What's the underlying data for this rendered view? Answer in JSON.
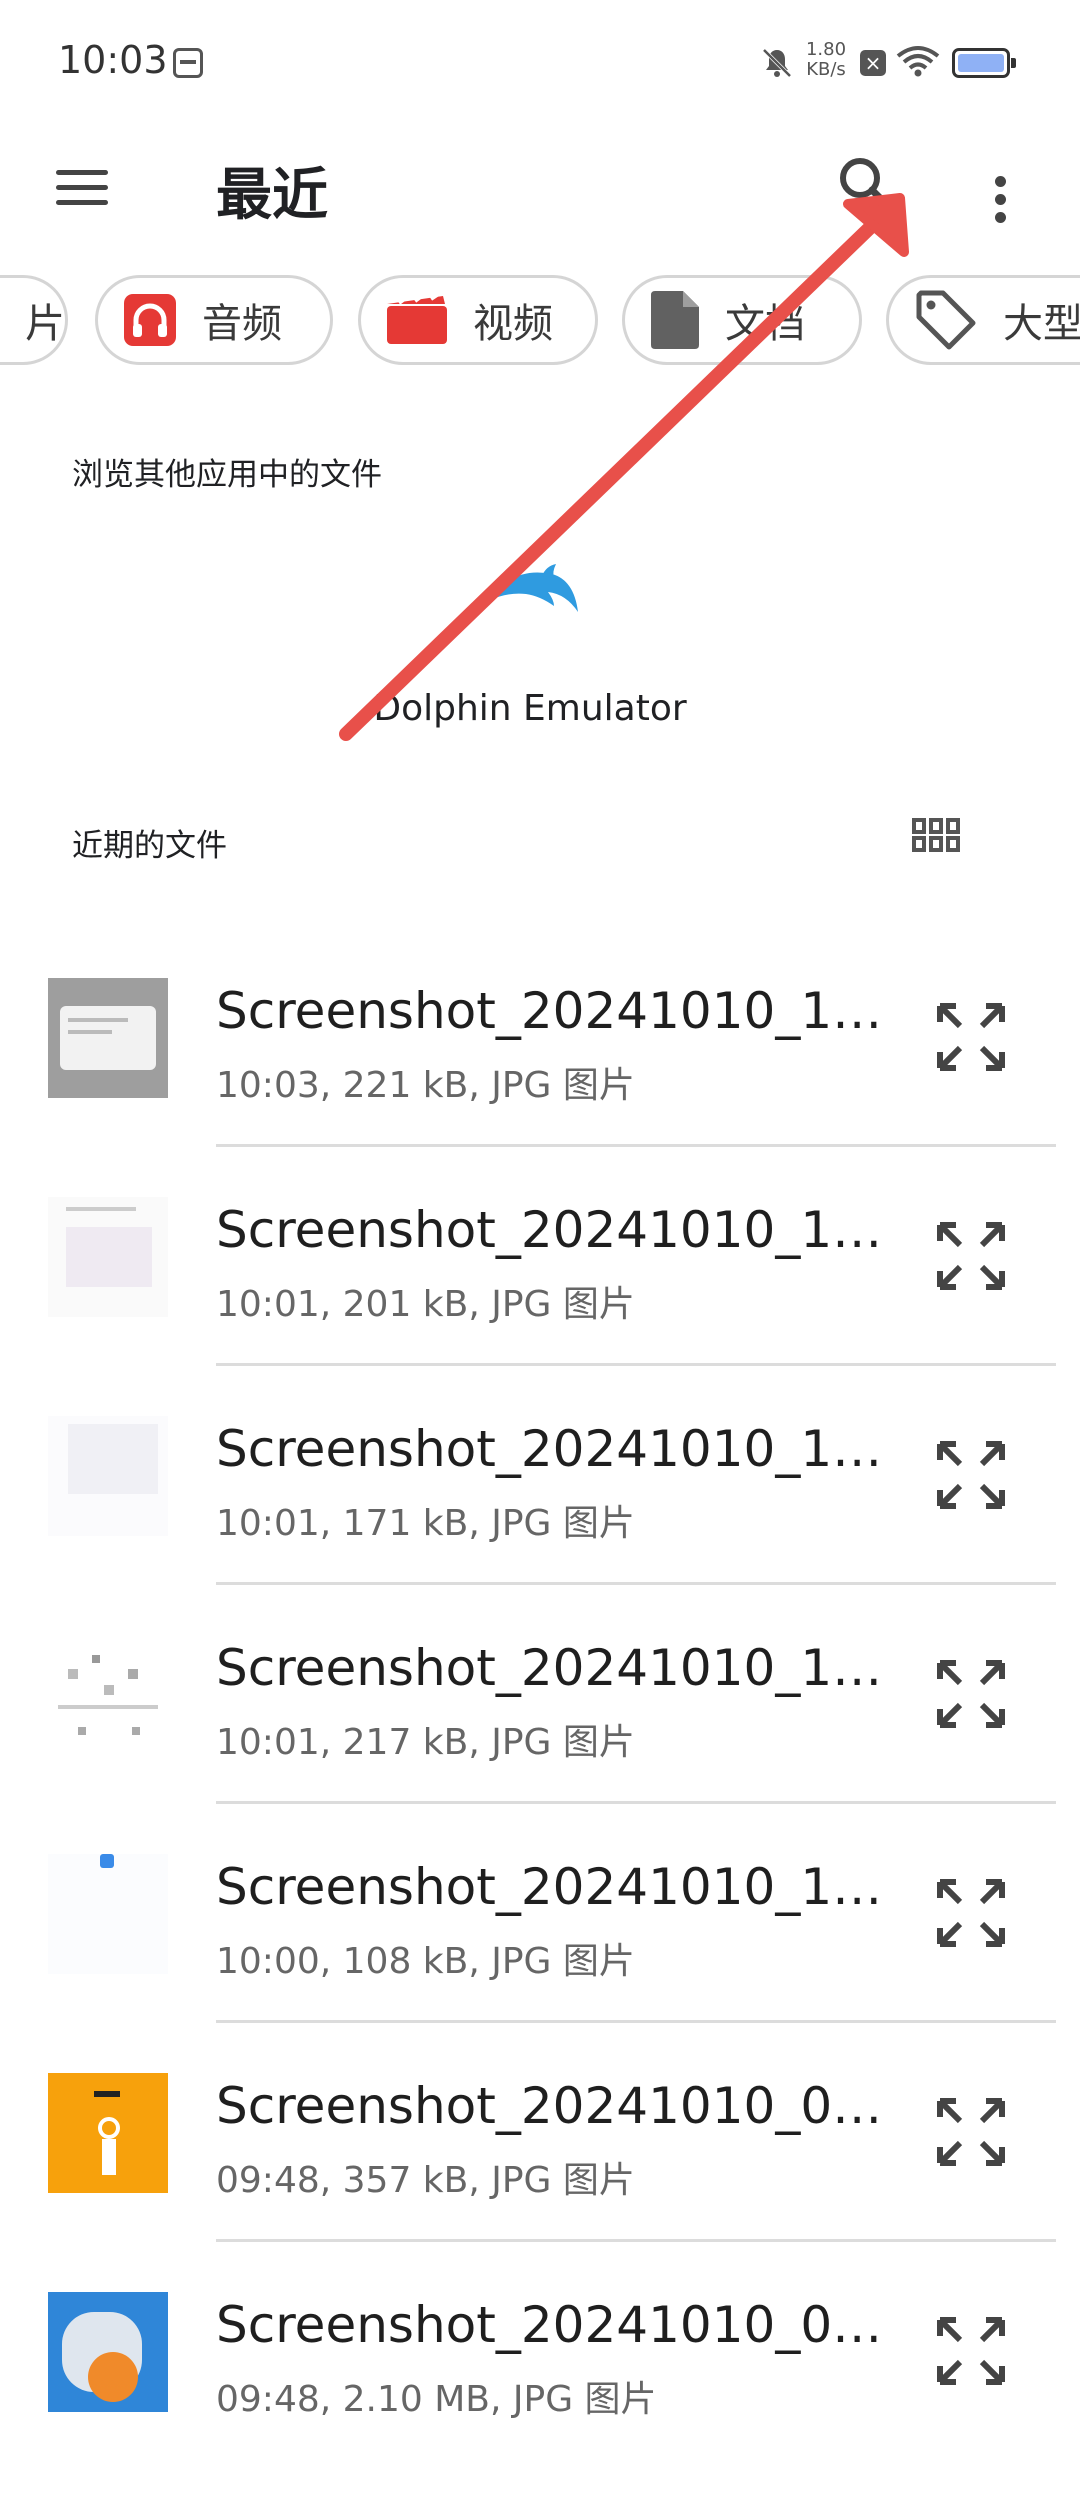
{
  "status_bar": {
    "time": "10:03",
    "net_speed_value": "1.80",
    "net_speed_unit": "KB/s",
    "icons": [
      "app-notification-icon",
      "bell-muted-icon",
      "close-box-icon",
      "wifi-icon",
      "battery-icon"
    ]
  },
  "app_bar": {
    "title": "最近",
    "icons": [
      "menu-icon",
      "search-icon",
      "more-vert-icon"
    ]
  },
  "chips": [
    {
      "label": "片",
      "icon": "image-icon"
    },
    {
      "label": "音频",
      "icon": "headphones-icon",
      "color": "#e53935"
    },
    {
      "label": "视频",
      "icon": "movie-icon",
      "color": "#e53935"
    },
    {
      "label": "文档",
      "icon": "document-icon",
      "color": "#616161"
    },
    {
      "label": "大型",
      "icon": "tag-icon",
      "color": "#555555"
    }
  ],
  "other_apps": {
    "header": "浏览其他应用中的文件",
    "apps": [
      {
        "name": "Dolphin Emulator",
        "icon": "dolphin-icon",
        "color": "#2f9be0"
      }
    ]
  },
  "recent": {
    "header": "近期的文件",
    "view_toggle_icon": "grid-view-icon",
    "files": [
      {
        "name": "Screenshot_20241010_1…",
        "meta": "10:03, 221 kB, JPG 图片"
      },
      {
        "name": "Screenshot_20241010_1…",
        "meta": "10:01, 201 kB, JPG 图片"
      },
      {
        "name": "Screenshot_20241010_1…",
        "meta": "10:01, 171 kB, JPG 图片"
      },
      {
        "name": "Screenshot_20241010_1…",
        "meta": "10:01, 217 kB, JPG 图片"
      },
      {
        "name": "Screenshot_20241010_1…",
        "meta": "10:00, 108 kB, JPG 图片"
      },
      {
        "name": "Screenshot_20241010_0…",
        "meta": "09:48, 357 kB, JPG 图片"
      },
      {
        "name": "Screenshot_20241010_0…",
        "meta": "09:48, 2.10 MB, JPG 图片"
      }
    ],
    "row_icon": "expand-icon"
  },
  "accent_colors": {
    "arrow": "#e8504a",
    "chip_border": "#d5d5d5"
  }
}
